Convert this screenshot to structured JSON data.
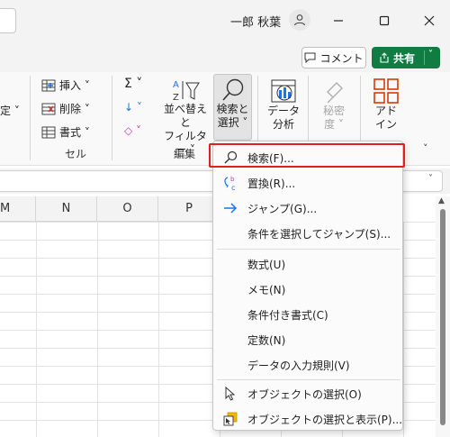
{
  "titlebar": {
    "user_name": "一郎 秋葉",
    "user_icon": "person-icon",
    "minimize_icon": "minimize-icon",
    "maximize_icon": "maximize-icon",
    "close_icon": "close-icon"
  },
  "ribbon_top": {
    "comment_label": "コメント",
    "share_label": "共有"
  },
  "ribbon": {
    "left_fragment": "定 ˅",
    "cells": {
      "insert": "挿入 ˅",
      "delete": "削除 ˅",
      "format": "書式 ˅",
      "group_label": "セル"
    },
    "editing": {
      "sum": "Σ ˅",
      "fill": "↓ ˅",
      "clear": "◇ ˅",
      "sort_filter": "並べ替えと\nフィルター ˅",
      "find_select": "検索と\n選択 ˅",
      "group_label": "編集"
    },
    "data_analysis": "データ\n分析",
    "sensitivity": "秘密\n度 ˅",
    "addins": "アド\nイン"
  },
  "columns": [
    "M",
    "N",
    "O",
    "P"
  ],
  "menu": {
    "items": [
      {
        "label": "検索(F)...",
        "icon": "search-icon"
      },
      {
        "label": "置換(R)...",
        "icon": "replace-icon"
      },
      {
        "label": "ジャンプ(G)...",
        "icon": "arrow-right-icon"
      },
      {
        "label": "条件を選択してジャンプ(S)...",
        "icon": ""
      },
      {
        "label": "数式(U)",
        "icon": ""
      },
      {
        "label": "メモ(N)",
        "icon": ""
      },
      {
        "label": "条件付き書式(C)",
        "icon": ""
      },
      {
        "label": "定数(N)",
        "icon": ""
      },
      {
        "label": "データの入力規則(V)",
        "icon": ""
      },
      {
        "label": "オブジェクトの選択(O)",
        "icon": "cursor-icon"
      },
      {
        "label": "オブジェクトの選択と表示(P)...",
        "icon": "selection-pane-icon"
      }
    ]
  },
  "colors": {
    "share_green": "#107c41",
    "highlight_red": "#e02020",
    "accent_blue": "#1a73e8"
  }
}
